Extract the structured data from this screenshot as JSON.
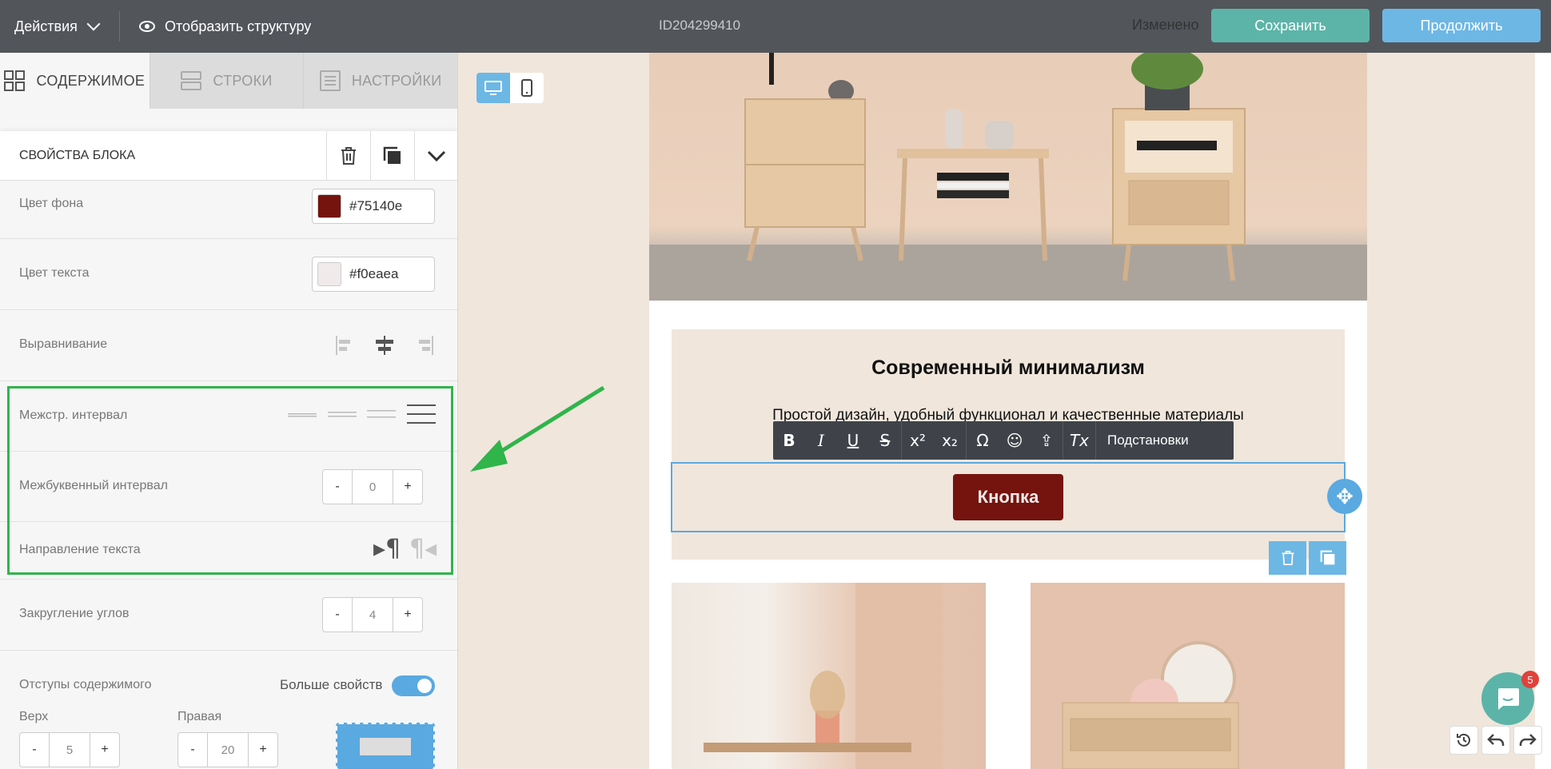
{
  "topbar": {
    "actions_label": "Действия",
    "structure_label": "Отобразить структуру",
    "doc_id": "ID204299410",
    "status": "Изменено",
    "save_label": "Сохранить",
    "continue_label": "Продолжить"
  },
  "tabs": [
    {
      "label": "СОДЕРЖИМОЕ"
    },
    {
      "label": "СТРОКИ"
    },
    {
      "label": "НАСТРОЙКИ"
    }
  ],
  "block": {
    "title": "СВОЙСТВА БЛОКА",
    "bg_color_label": "Цвет фона",
    "bg_color_value": "#75140e",
    "text_color_label": "Цвет текста",
    "text_color_value": "#f0eaea",
    "align_label": "Выравнивание",
    "line_height_label": "Межстр. интервал",
    "letter_spacing_label": "Межбуквенный интервал",
    "letter_spacing_value": "0",
    "text_direction_label": "Направление текста",
    "radius_label": "Закругление углов",
    "radius_value": "4",
    "padding_label": "Отступы содержимого",
    "more_props_label": "Больше свойств",
    "more_props_on": true,
    "top_label": "Верх",
    "top_value": "5",
    "right_label": "Правая",
    "right_value": "20",
    "minus": "-",
    "plus": "+"
  },
  "email": {
    "heading": "Современный минимализм",
    "subheading": "Простой дизайн, удобный функционал и качественные материалы",
    "button_label": "Кнопка"
  },
  "toolbar": {
    "bold": "B",
    "italic": "I",
    "underline": "U",
    "strike": "S",
    "superscript": "x²",
    "subscript": "x₂",
    "omega": "Ω",
    "emoji": "☺",
    "upload": "⇪",
    "clear": "Tx",
    "substitutions": "Подстановки"
  },
  "chat": {
    "badge": "5"
  },
  "colors": {
    "topbar": "#52565b",
    "accent_teal": "#5cb4a9",
    "accent_blue": "#6db7e5",
    "button_bg": "#75140e",
    "button_text": "#f0eaea",
    "highlight": "#2fb54a"
  }
}
